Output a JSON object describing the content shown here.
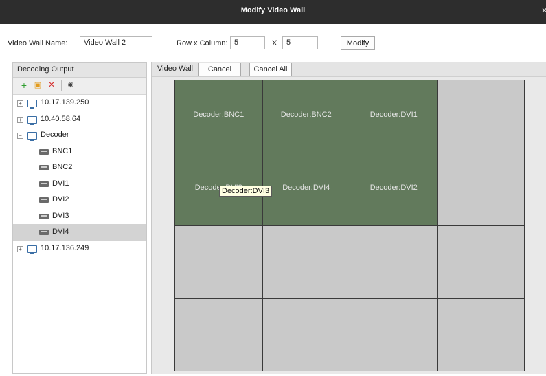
{
  "window": {
    "title": "Modify Video Wall",
    "close_glyph": "×"
  },
  "form": {
    "name_label": "Video Wall Name:",
    "name_value": "Video Wall 2",
    "rowcol_label": "Row x Column:",
    "rows_value": "5",
    "x_separator": "X",
    "cols_value": "5",
    "modify_label": "Modify"
  },
  "left_panel": {
    "header": "Decoding Output",
    "toolbar": [
      {
        "name": "add-icon",
        "glyph": "+",
        "color": "#2e9e2e"
      },
      {
        "name": "edit-icon",
        "glyph": "▣",
        "color": "#e39b1b"
      },
      {
        "name": "delete-icon",
        "glyph": "×",
        "color": "#d42a2a"
      },
      {
        "name": "view-icon",
        "glyph": "◉",
        "color": "#444444"
      }
    ],
    "tree": [
      {
        "label": "10.17.139.250",
        "kind": "device",
        "expand": "+",
        "selected": false
      },
      {
        "label": "10.40.58.64",
        "kind": "device",
        "expand": "+",
        "selected": false
      },
      {
        "label": "Decoder",
        "kind": "device",
        "expand": "−",
        "selected": false
      },
      {
        "label": "BNC1",
        "kind": "channel",
        "selected": false
      },
      {
        "label": "BNC2",
        "kind": "channel",
        "selected": false
      },
      {
        "label": "DVI1",
        "kind": "channel",
        "selected": false
      },
      {
        "label": "DVI2",
        "kind": "channel",
        "selected": false
      },
      {
        "label": "DVI3",
        "kind": "channel",
        "selected": false
      },
      {
        "label": "DVI4",
        "kind": "channel",
        "selected": true
      },
      {
        "label": "10.17.136.249",
        "kind": "device",
        "expand": "+",
        "selected": false
      }
    ]
  },
  "right_panel": {
    "header": "Video Wall",
    "cancel_label": "Cancel",
    "cancel_all_label": "Cancel All",
    "active_color": "#627a5c",
    "empty_color": "#c9c9c9",
    "rows": [
      [
        "Decoder:BNC1",
        "Decoder:BNC2",
        "Decoder:DVI1",
        ""
      ],
      [
        "Decoder:DVI3",
        "Decoder:DVI4",
        "Decoder:DVI2",
        ""
      ],
      [
        "",
        "",
        "",
        ""
      ],
      [
        "",
        "",
        "",
        ""
      ]
    ],
    "tooltip": "Decoder:DVI3"
  }
}
